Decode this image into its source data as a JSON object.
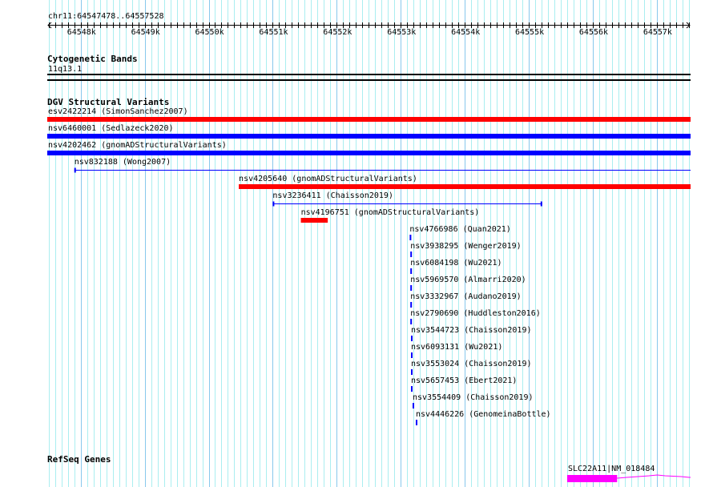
{
  "ruler": {
    "location": "chr11:64547478..64557528",
    "start": 64547478,
    "end": 64557528,
    "tick_labels": [
      "64548k",
      "64549k",
      "64550k",
      "64551k",
      "64552k",
      "64553k",
      "64554k",
      "64555k",
      "64556k",
      "64557k"
    ]
  },
  "cyto": {
    "title": "Cytogenetic Bands",
    "band": "11q13.1"
  },
  "dgv": {
    "title": "DGV Structural Variants",
    "features": [
      {
        "label": "esv2422214 (SimonSanchez2007)",
        "color": "#ff0000",
        "style": "thick",
        "start": 64547478,
        "end": 64557528
      },
      {
        "label": "nsv6460001 (Sedlazeck2020)",
        "color": "#0000ff",
        "style": "thick",
        "start": 64547478,
        "end": 64557528
      },
      {
        "label": "nsv4202462 (gnomADStructuralVariants)",
        "color": "#0000ff",
        "style": "thick",
        "start": 64547478,
        "end": 64557528
      },
      {
        "label": "nsv832188 (Wong2007)",
        "color": "#0000ff",
        "style": "line",
        "start": 64547900,
        "end": 64557528
      },
      {
        "label": "nsv4205640 (gnomADStructuralVariants)",
        "color": "#ff0000",
        "style": "thick",
        "start": 64550470,
        "end": 64557528
      },
      {
        "label": "nsv3236411 (Chaisson2019)",
        "color": "#0000ff",
        "style": "line",
        "start": 64551000,
        "end": 64555210
      },
      {
        "label": "nsv4196751 (gnomADStructuralVariants)",
        "color": "#ff0000",
        "style": "thick",
        "start": 64551440,
        "end": 64551860
      },
      {
        "label": "nsv4766986 (Quan2021)",
        "color": "#0000ff",
        "style": "thick",
        "start": 64553140,
        "end": 64553165
      },
      {
        "label": "nsv3938295 (Wenger2019)",
        "color": "#0000ff",
        "style": "thick",
        "start": 64553150,
        "end": 64553175
      },
      {
        "label": "nsv6084198 (Wu2021)",
        "color": "#0000ff",
        "style": "thick",
        "start": 64553150,
        "end": 64553175
      },
      {
        "label": "nsv5969570 (Almarri2020)",
        "color": "#0000ff",
        "style": "thick",
        "start": 64553150,
        "end": 64553175
      },
      {
        "label": "nsv3332967 (Audano2019)",
        "color": "#0000ff",
        "style": "thick",
        "start": 64553150,
        "end": 64553175
      },
      {
        "label": "nsv2790690 (Huddleston2016)",
        "color": "#0000ff",
        "style": "thick",
        "start": 64553150,
        "end": 64553175
      },
      {
        "label": "nsv3544723 (Chaisson2019)",
        "color": "#0000ff",
        "style": "thick",
        "start": 64553160,
        "end": 64553185
      },
      {
        "label": "nsv6093131 (Wu2021)",
        "color": "#0000ff",
        "style": "thick",
        "start": 64553160,
        "end": 64553185
      },
      {
        "label": "nsv3553024 (Chaisson2019)",
        "color": "#0000ff",
        "style": "thick",
        "start": 64553160,
        "end": 64553185
      },
      {
        "label": "nsv5657453 (Ebert2021)",
        "color": "#0000ff",
        "style": "thick",
        "start": 64553160,
        "end": 64553185
      },
      {
        "label": "nsv3554409 (Chaisson2019)",
        "color": "#0000ff",
        "style": "thick",
        "start": 64553185,
        "end": 64553210
      },
      {
        "label": "nsv4446226 (GenomeinaBottle)",
        "color": "#0000ff",
        "style": "thick",
        "start": 64553235,
        "end": 64553260
      }
    ]
  },
  "refseq": {
    "title": "RefSeq Genes",
    "gene": {
      "label": "SLC22A11|NM_018484",
      "color": "#ff00ff",
      "exon_start": 64555600,
      "exon_end": 64556380,
      "end": 64557528
    }
  },
  "colors": {
    "grid_minor": "#aaeef0",
    "grid_major": "#88c8ec"
  }
}
